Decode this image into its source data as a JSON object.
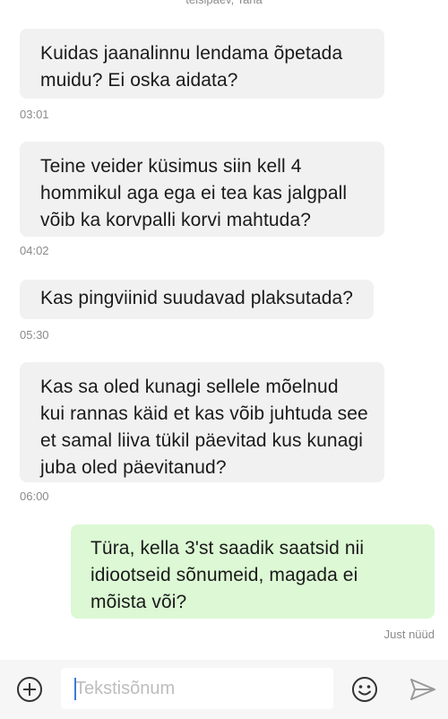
{
  "header": {
    "date_label": "teisipäev, Tana"
  },
  "messages": [
    {
      "direction": "incoming",
      "lines": [
        "Kuidas jaanalinnu lendama õpetada",
        "muidu? Ei oska aidata?"
      ],
      "time": "03:01"
    },
    {
      "direction": "incoming",
      "lines": [
        "Teine veider küsimus siin kell 4",
        "hommikul aga ega ei tea kas jalgpall",
        "võib ka korvpalli korvi mahtuda?"
      ],
      "time": "04:02"
    },
    {
      "direction": "incoming",
      "lines": [
        "Kas pingviinid suudavad plaksutada?"
      ],
      "time": "05:30"
    },
    {
      "direction": "incoming",
      "lines": [
        "Kas sa oled kunagi sellele mõelnud",
        "kui rannas käid et kas võib juhtuda see",
        "et samal liiva tükil päevitad kus kunagi",
        "juba oled päevitanud?"
      ],
      "time": "06:00"
    },
    {
      "direction": "outgoing",
      "lines": [
        "Türa, kella 3'st saadik saatsid nii",
        "idiootseid sõnumeid, magada ei",
        "mõista või?"
      ],
      "status": "Just nüüd"
    }
  ],
  "composer": {
    "placeholder": "Tekstisõnum",
    "value": ""
  },
  "icons": {
    "attach": "plus-circle-icon",
    "emoji": "smiley-icon",
    "send": "send-icon"
  },
  "colors": {
    "incoming_bubble": "#f1f1f1",
    "outgoing_bubble": "#dcf8d4",
    "meta_text": "#8a8a8a",
    "composer_bg": "#f6f6f6",
    "caret": "#3a7bd5"
  }
}
